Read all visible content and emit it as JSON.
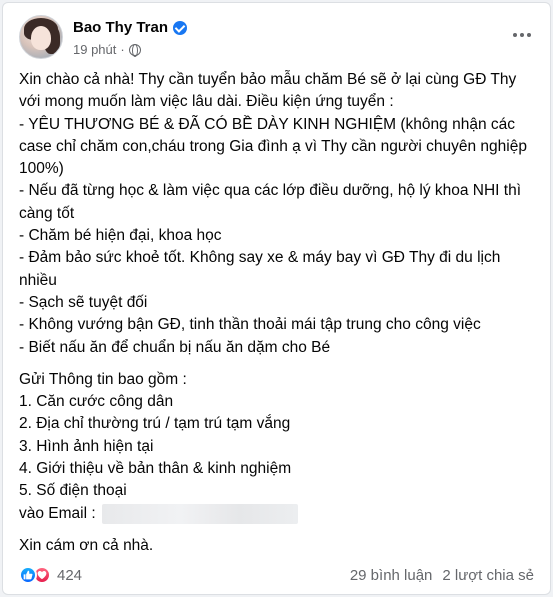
{
  "post": {
    "author": "Bao Thy Tran",
    "time": "19 phút",
    "separator": "·",
    "lines_intro": [
      "Xin chào cả nhà! Thy cần tuyển bảo mẫu chăm Bé sẽ ở lại cùng GĐ Thy với mong muốn làm việc lâu dài. Điều kiện ứng tuyển :",
      "- YÊU THƯƠNG BÉ & ĐÃ CÓ BỀ DÀY KINH NGHIỆM (không nhận các case chỉ chăm con,cháu trong Gia đình ạ vì Thy cần người chuyên nghiệp 100%)",
      "- Nếu đã từng học & làm việc qua các lớp điều dưỡng, hộ lý khoa NHI thì càng tốt",
      "- Chăm bé hiện đại, khoa học",
      "- Đảm bảo sức khoẻ tốt. Không say xe & máy bay vì GĐ Thy đi du lịch nhiều",
      "- Sạch sẽ tuyệt đối",
      "- Không vướng bận GĐ, tinh thần thoải mái tập trung cho công việc",
      "- Biết nấu ăn để chuẩn bị nấu ăn dặm cho Bé"
    ],
    "info_heading": "Gửi Thông tin bao gồm :",
    "info_items": [
      "1. Căn cước công dân",
      "2. Địa chỉ thường trú / tạm trú tạm vắng",
      "3. Hình ảnh hiện tại",
      "4. Giới thiệu về bản thân & kinh nghiệm",
      "5. Số điện thoại"
    ],
    "email_label": "vào Email :",
    "closing": "Xin cám ơn cả nhà."
  },
  "footer": {
    "reaction_count": "424",
    "comments": "29 bình luận",
    "shares": "2 lượt chia sẻ"
  },
  "icons": {
    "verified": "verified-badge-icon",
    "privacy": "globe-icon",
    "more": "more-horizontal-icon",
    "like": "like-reaction-icon",
    "love": "love-reaction-icon"
  },
  "colors": {
    "accent": "#1877f2",
    "text": "#050505",
    "muted": "#65676b",
    "love": "#e61e4d"
  }
}
